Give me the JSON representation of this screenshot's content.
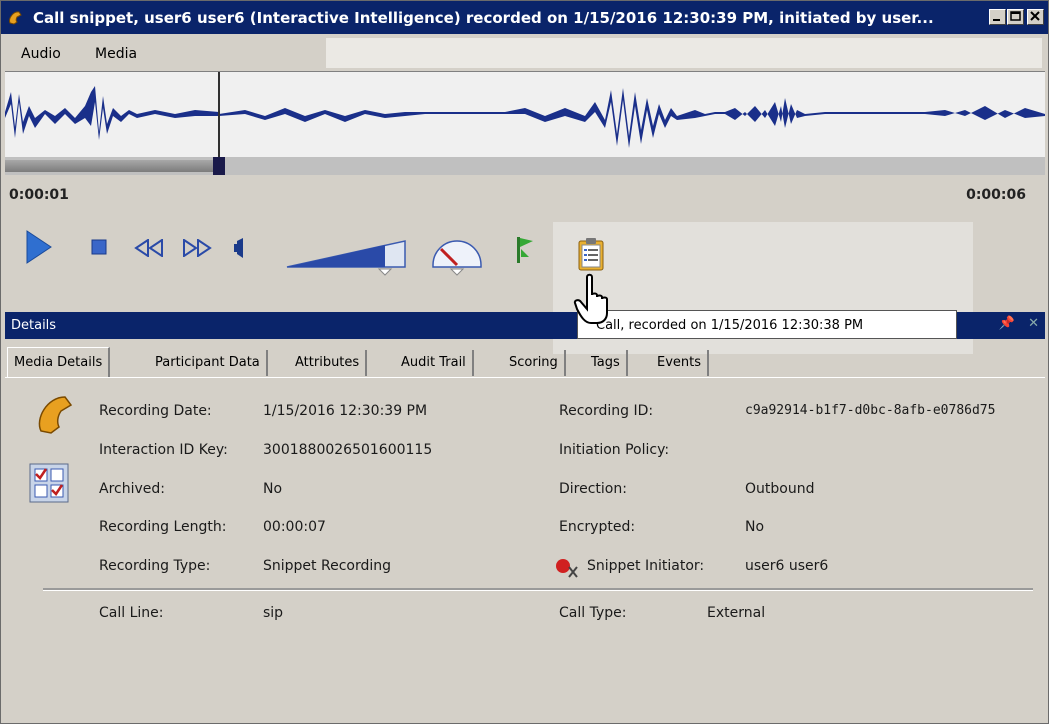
{
  "window": {
    "title": "Call snippet, user6 user6 (Interactive Intelligence) recorded on 1/15/2016 12:30:39 PM, initiated by user..."
  },
  "menu": {
    "items": [
      "Audio",
      "Media"
    ]
  },
  "playback": {
    "time_start": "0:00:01",
    "time_end": "0:00:06"
  },
  "details_panel": {
    "title": "Details"
  },
  "tooltip": {
    "text": "Call,  recorded on 1/15/2016 12:30:38 PM"
  },
  "tabs": [
    "Media Details",
    "Participant Data",
    "Attributes",
    "Audit Trail",
    "Scoring",
    "Tags",
    "Events"
  ],
  "media_details": {
    "left": [
      {
        "label": "Recording Date:",
        "value": "1/15/2016 12:30:39 PM"
      },
      {
        "label": "Interaction ID Key:",
        "value": "3001880026501600115"
      },
      {
        "label": "Archived:",
        "value": "No"
      },
      {
        "label": "Recording Length:",
        "value": "00:00:07"
      },
      {
        "label": "Recording Type:",
        "value": "Snippet Recording"
      }
    ],
    "right": [
      {
        "label": "Recording ID:",
        "value": "c9a92914-b1f7-d0bc-8afb-e0786d75"
      },
      {
        "label": "Initiation Policy:",
        "value": ""
      },
      {
        "label": "Direction:",
        "value": "Outbound"
      },
      {
        "label": "Encrypted:",
        "value": "No"
      },
      {
        "label": "Snippet Initiator:",
        "value": "user6 user6"
      }
    ],
    "call_line_label": "Call Line:",
    "call_line_value": "sip",
    "call_type_label": "Call Type:",
    "call_type_value": "External"
  },
  "colors": {
    "titlebar": "#0a246a",
    "waveform": "#1a2f8a",
    "play": "#2f6fd0",
    "window_bg": "#d4d0c8"
  }
}
